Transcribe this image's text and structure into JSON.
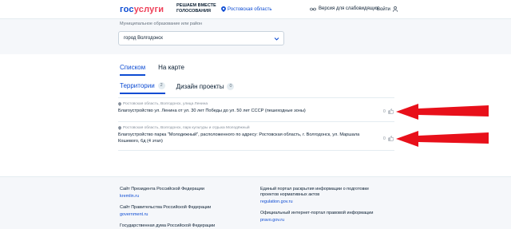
{
  "header": {
    "logo_part1": "гос",
    "logo_part2": "услуги",
    "slogan_line1": "Решаем вместе",
    "slogan_line2": "Голосования",
    "region": "Ростовская область",
    "vision_label": "Версия для слабовидящих",
    "login_label": "Войти"
  },
  "filter": {
    "label": "Муниципальное образование или район",
    "selected": "город Волгодонск"
  },
  "view_tabs": [
    {
      "label": "Списком",
      "active": true
    },
    {
      "label": "На карте",
      "active": false
    }
  ],
  "category_tabs": [
    {
      "label": "Территории",
      "count": "2",
      "active": true
    },
    {
      "label": "Дизайн проекты",
      "count": "0",
      "active": false
    }
  ],
  "items": [
    {
      "location": "Ростовская область, Волгодонск, улица Ленина",
      "title": "Благоустройство ул. Ленина от ул. 30 лет Победы до ул. 50 лет СССР (пешеходные зоны)",
      "likes": "0"
    },
    {
      "location": "Ростовская область, Волгодонск, парк культуры и отдыха Молодёжный",
      "title": "Благоустройство парка \"Молодежный\", расположенного по адресу: Ростовская область, г. Волгодонск, ул. Маршала Кошевого, 6д (4 этап)",
      "likes": "0"
    }
  ],
  "annotation_color": "#e8101a",
  "footer": {
    "left": [
      {
        "text": "Сайт Президента Российской Федерации",
        "link": "kremlin.ru"
      },
      {
        "text": "Сайт Правительства Российской Федерации",
        "link": "government.ru"
      },
      {
        "text": "Государственная дума Российской Федерации",
        "link": ""
      }
    ],
    "right": [
      {
        "text": "Единый портал раскрытия информации о подготовке проектов нормативных актов",
        "link": "regulation.gov.ru"
      },
      {
        "text": "Официальный интернет-портал правовой информации",
        "link": "pravo.gov.ru"
      }
    ]
  }
}
